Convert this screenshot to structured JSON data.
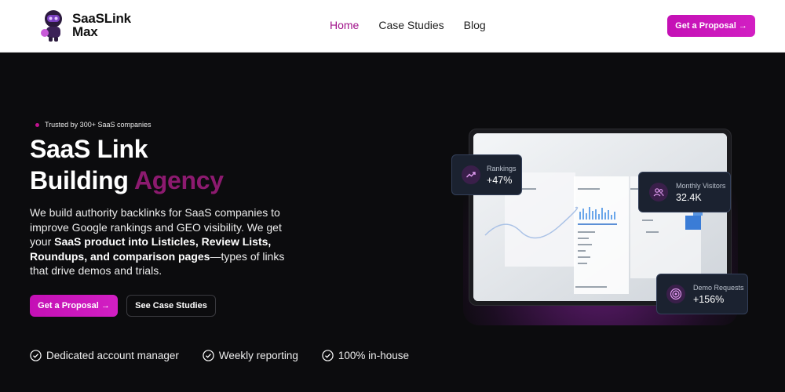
{
  "brand": {
    "name_line1": "SaaSLink",
    "name_line2": "Max",
    "primary_color": "#c410b5",
    "accent_text_color": "#8c1a6f"
  },
  "nav": {
    "links": [
      {
        "label": "Home",
        "active": true
      },
      {
        "label": "Case Studies",
        "active": false
      },
      {
        "label": "Blog",
        "active": false
      }
    ],
    "cta_label": "Get a Proposal →"
  },
  "hero": {
    "trusted_text": "Trusted by 300+ SaaS companies",
    "title_line1": "SaaS Link",
    "title_line2_plain": "Building ",
    "title_line2_accent": "Agency",
    "desc_part1": "We build authority backlinks for SaaS companies to improve Google rankings and GEO visibility. We get your ",
    "desc_bold": "SaaS product into Listicles, Review Lists, Roundups, and comparison pages",
    "desc_part2": "—types of links that drive demos and trials.",
    "primary_button": "Get a Proposal →",
    "secondary_button": "See Case Studies",
    "features": [
      "Dedicated account manager",
      "Weekly reporting",
      "100% in-house"
    ]
  },
  "stats": {
    "rankings": {
      "label": "Rankings",
      "value": "+47%",
      "icon": "trend-up-icon"
    },
    "visitors": {
      "label": "Monthly Visitors",
      "value": "32.4K",
      "icon": "users-icon"
    },
    "demos": {
      "label": "Demo Requests",
      "value": "+156%",
      "icon": "target-icon"
    }
  }
}
